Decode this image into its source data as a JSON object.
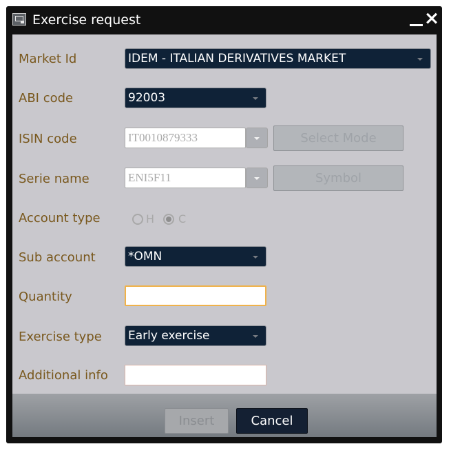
{
  "window": {
    "title": "Exercise request",
    "icons": {
      "app": "terminal-window-icon",
      "minimize": "minimize-icon",
      "close": "close-icon"
    }
  },
  "form": {
    "labels": {
      "market_id": "Market Id",
      "abi_code": "ABI code",
      "isin_code": "ISIN code",
      "serie_name": "Serie name",
      "account_type": "Account type",
      "sub_account": "Sub account",
      "quantity": "Quantity",
      "exercise_type": "Exercise type",
      "additional_info": "Additional info"
    },
    "values": {
      "market_id": "IDEM - ITALIAN DERIVATIVES MARKET",
      "abi_code": "92003",
      "isin_code": "IT0010879333",
      "serie_name": "ENI5F11",
      "sub_account": "*OMN",
      "quantity": "",
      "exercise_type": "Early exercise",
      "additional_info": ""
    },
    "buttons": {
      "select_mode": "Select Mode",
      "symbol": "Symbol",
      "insert": "Insert",
      "cancel": "Cancel"
    },
    "account_type": {
      "options": [
        "H",
        "C"
      ],
      "selected": "C"
    }
  },
  "colors": {
    "label": "#79581d",
    "panel": "#c9c8cd",
    "field_dark": "#0f2237",
    "quantity_focus": "#f0b24a",
    "cancel_button": "#142033"
  }
}
